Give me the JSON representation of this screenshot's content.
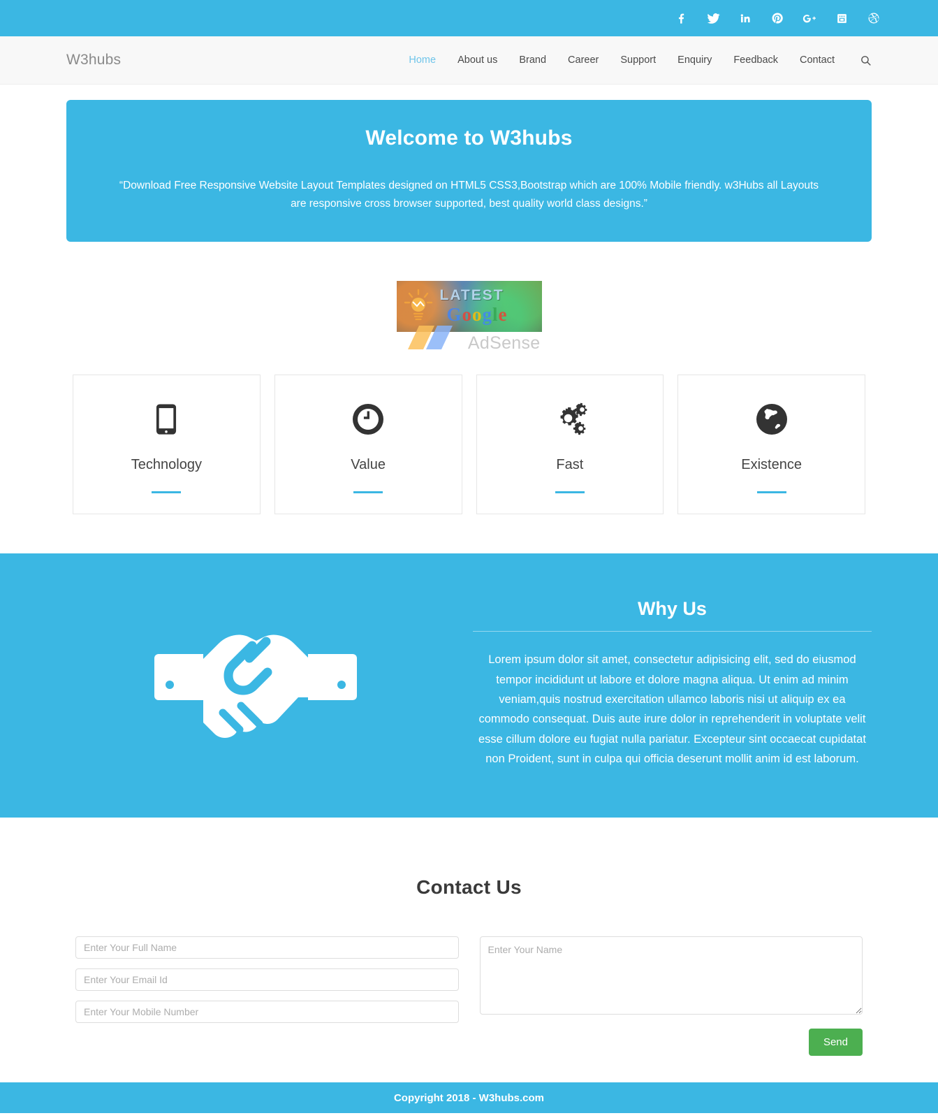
{
  "social": {
    "items": [
      {
        "name": "facebook-icon",
        "label": "Facebook"
      },
      {
        "name": "twitter-icon",
        "label": "Twitter"
      },
      {
        "name": "linkedin-icon",
        "label": "LinkedIn"
      },
      {
        "name": "pinterest-icon",
        "label": "Pinterest"
      },
      {
        "name": "google-plus-icon",
        "label": "Google Plus"
      },
      {
        "name": "youtube-icon",
        "label": "YouTube"
      },
      {
        "name": "dribbble-icon",
        "label": "Dribbble"
      }
    ]
  },
  "navbar": {
    "brand": "W3hubs",
    "links": [
      {
        "label": "Home",
        "active": true
      },
      {
        "label": "About us",
        "active": false
      },
      {
        "label": "Brand",
        "active": false
      },
      {
        "label": "Career",
        "active": false
      },
      {
        "label": "Support",
        "active": false
      },
      {
        "label": "Enquiry",
        "active": false
      },
      {
        "label": "Feedback",
        "active": false
      },
      {
        "label": "Contact",
        "active": false
      }
    ],
    "search_icon": "search-icon"
  },
  "hero": {
    "title": "Welcome to W3hubs",
    "text": "“Download Free Responsive Website Layout Templates designed on HTML5 CSS3,Bootstrap which are 100% Mobile friendly. w3Hubs all Layouts are responsive cross browser supported, best quality world class designs.”"
  },
  "ad": {
    "latest_text": "LATEST",
    "google_letters": [
      "G",
      "o",
      "o",
      "g",
      "l",
      "e"
    ],
    "adsense_text": "AdSense"
  },
  "features": {
    "cards": [
      {
        "title": "Technology",
        "icon": "mobile-phone-icon"
      },
      {
        "title": "Value",
        "icon": "clock-icon"
      },
      {
        "title": "Fast",
        "icon": "gears-icon"
      },
      {
        "title": "Existence",
        "icon": "globe-icon"
      }
    ]
  },
  "whyus": {
    "icon": "handshake-icon",
    "title": "Why Us",
    "text": "Lorem ipsum dolor sit amet, consectetur adipisicing elit, sed do eiusmod tempor incididunt ut labore et dolore magna aliqua. Ut enim ad minim veniam,quis nostrud exercitation ullamco laboris nisi ut aliquip ex ea commodo consequat. Duis aute irure dolor in reprehenderit in voluptate velit esse cillum dolore eu fugiat nulla pariatur. Excepteur sint occaecat cupidatat non Proident, sunt in culpa qui officia deserunt mollit anim id est laborum."
  },
  "contact": {
    "title": "Contact Us",
    "full_name_placeholder": "Enter Your Full Name",
    "email_placeholder": "Enter Your Email Id",
    "mobile_placeholder": "Enter Your Mobile Number",
    "message_placeholder": "Enter Your Name",
    "full_name_value": "",
    "email_value": "",
    "mobile_value": "",
    "message_value": "",
    "send_label": "Send"
  },
  "footer": {
    "copyright": "Copyright 2018 - W3hubs.com"
  },
  "colors": {
    "brand_blue": "#3BB7E3",
    "nav_active": "#6fc5ea",
    "send_green": "#4CAF50",
    "navbar_bg": "#f8f8f8"
  }
}
